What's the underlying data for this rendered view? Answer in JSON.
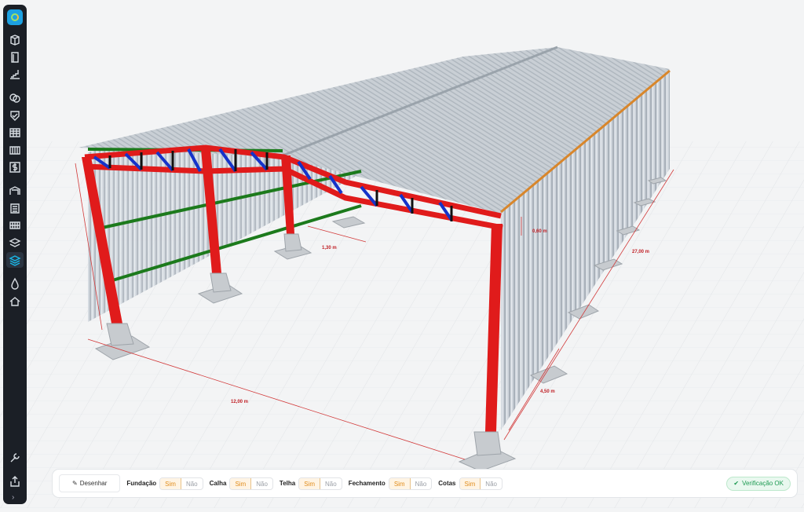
{
  "dimensions": {
    "span": "12,00 m",
    "length": "27,00 m",
    "bay": "4,50 m",
    "truss_height": "0,60 m",
    "overhang": "1,30 m"
  },
  "sidebar": {
    "tools": [
      "logo-icon",
      "cube-icon",
      "door-icon",
      "stairs-icon",
      "rings-icon",
      "shield-icon",
      "table-icon",
      "columns-icon",
      "dollar-icon",
      "hangar-icon",
      "list-icon",
      "fence-icon",
      "layers-icon",
      "stack-icon",
      "drop-icon",
      "roof-icon"
    ],
    "bottom": [
      "wrench-icon",
      "export-icon",
      "chevron-right-icon"
    ],
    "active": "stack-icon"
  },
  "bar": {
    "draw_label": "Desenhar",
    "options": [
      {
        "label": "Fundação",
        "yes": "Sim",
        "no": "Não"
      },
      {
        "label": "Calha",
        "yes": "Sim",
        "no": "Não"
      },
      {
        "label": "Telha",
        "yes": "Sim",
        "no": "Não"
      },
      {
        "label": "Fechamento",
        "yes": "Sim",
        "no": "Não"
      },
      {
        "label": "Cotas",
        "yes": "Sim",
        "no": "Não"
      }
    ],
    "status": "Verificação OK"
  },
  "colors": {
    "steel": "#e01b1b",
    "truss_blue": "#1533c9",
    "purlin_green": "#1c7a1c",
    "accent": "#e08c1b",
    "ok_green": "#1d9a52"
  }
}
